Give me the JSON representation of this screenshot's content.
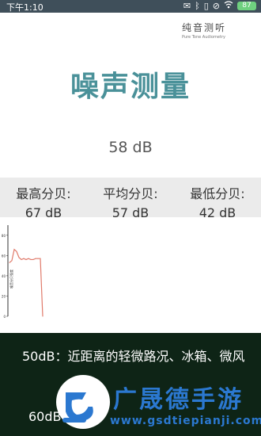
{
  "status_bar": {
    "time": "下午1:10",
    "icons": [
      "mail-icon",
      "bluetooth-icon",
      "vibrate-icon",
      "mute-icon",
      "wifi-icon",
      "battery-icon"
    ],
    "battery_level": "87"
  },
  "brand": {
    "title": "纯音测听",
    "subtitle": "Pure Tone Audiometry"
  },
  "app_title": "噪声测量",
  "current_reading": "58 dB",
  "stats": [
    {
      "label": "最高分贝:",
      "value": "67 dB"
    },
    {
      "label": "平均分贝:",
      "value": "57 dB"
    },
    {
      "label": "最低分贝:",
      "value": "42 dB"
    }
  ],
  "chart_data": {
    "type": "line",
    "ylabel": "噪音分贝强度",
    "y_ticks": [
      "80",
      "60",
      "40",
      "20",
      "0"
    ],
    "ylim": [
      0,
      90
    ],
    "x": [
      0,
      1,
      2,
      3,
      4,
      5,
      6,
      7,
      8,
      9,
      10,
      11,
      12,
      13,
      14
    ],
    "values": [
      53,
      55,
      66,
      64,
      58,
      56,
      57,
      56,
      57,
      56,
      56,
      57,
      57,
      57,
      0
    ],
    "color": "#e07a6a"
  },
  "info": {
    "line1": "50dB：近距离的轻微路况、冰箱、微风",
    "line2": "60dB"
  },
  "watermark": {
    "title": "广晟德手游",
    "url": "www.gsdtiepianji.com",
    "brand_color": "#2b78d0"
  }
}
